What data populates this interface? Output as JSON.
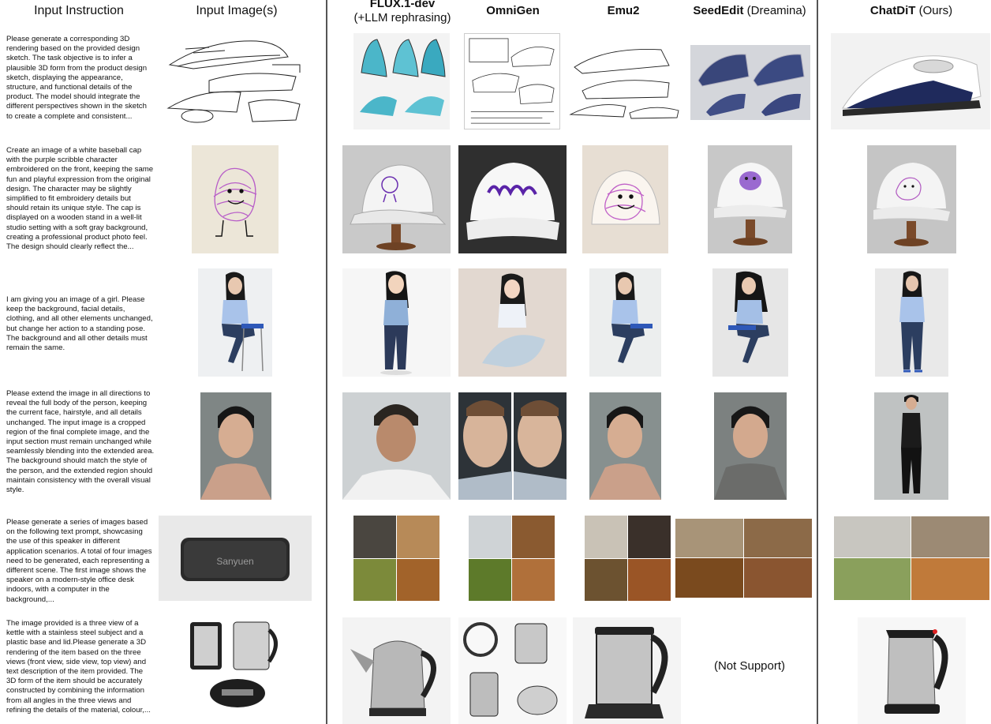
{
  "headers": {
    "input_instruction": "Input Instruction",
    "input_images": "Input Image(s)",
    "flux_name": "FLUX.1-dev",
    "flux_sub": "(+LLM rephrasing)",
    "omnigen": "OmniGen",
    "emu2": "Emu2",
    "seededit_name": "SeedEdit",
    "seededit_sub": " (Dreamina)",
    "chatdit_name": "ChatDiT",
    "chatdit_sub": " (Ours)"
  },
  "rows": [
    {
      "instruction": "Please generate a corresponding 3D rendering based on the provided design sketch. The task objective is to infer a plausible 3D form from the product design sketch, displaying the appearance, structure, and functional details of the product. The model should integrate the different perspectives shown in the sketch to create a complete and consistent..."
    },
    {
      "instruction": "Create an image of a white baseball cap with the purple scribble character embroidered on the front, keeping the same fun and playful expression from the original design. The character may be slightly simplified to fit embroidery details but should retain its unique style. The cap is displayed on a wooden stand in a well-lit studio setting with a soft gray background, creating a professional product photo feel. The design should clearly reflect the..."
    },
    {
      "instruction": "I am giving you an image of a girl. Please keep the background, facial details, clothing, and all other elements unchanged, but change her action to a standing pose. The background and all other details must remain the same."
    },
    {
      "instruction": "Please extend the image in all directions to reveal the full body of the person, keeping the current face, hairstyle, and all details unchanged. The input image is a cropped region of the final complete image, and the input section must remain unchanged while seamlessly blending into the extended area. The background should match the style of the person, and the extended region should maintain consistency with the overall visual style."
    },
    {
      "instruction": "Please generate a series of images based on the following text prompt, showcasing the use of this speaker in different application scenarios. A total of four images need to be generated, each representing a different scene. The first image shows the speaker on a modern-style office desk indoors, with a computer in the background,..."
    },
    {
      "instruction": "The image provided is a three view of a kettle with a stainless steel subject and a plastic base and lid.Please generate a 3D rendering of the item based on the three views (front view, side view, top view) and text description of the item provided. The 3D form of the item should be accurately constructed by combining the information from all angles in the three views and refining the details of the material, colour,..."
    }
  ],
  "not_supported": "(Not Support)",
  "speaker_brand": "Sanyuen"
}
